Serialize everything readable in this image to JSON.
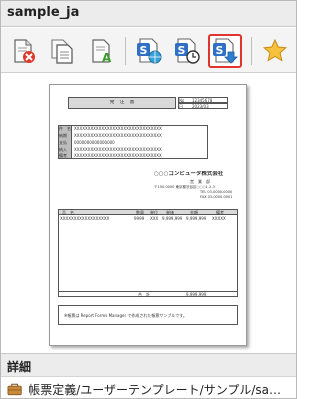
{
  "window": {
    "title": "sample_ja"
  },
  "toolbar": {
    "buttons": [
      {
        "name": "delete-form-button",
        "icon": "document-delete-icon"
      },
      {
        "name": "copy-form-button",
        "icon": "document-copy-icon"
      },
      {
        "name": "rename-form-button",
        "icon": "document-text-icon"
      },
      {
        "name": "preview-form-button",
        "icon": "s-document-globe-icon"
      },
      {
        "name": "schedule-form-button",
        "icon": "s-document-clock-icon"
      },
      {
        "name": "download-form-button",
        "icon": "s-document-download-icon",
        "active": true
      },
      {
        "name": "favorite-button",
        "icon": "star-icon"
      }
    ],
    "accent_color": "#e0342c"
  },
  "preview": {
    "doc_title": "発　注　書",
    "no_label": "No",
    "no_value": "12345678",
    "date_label": "日",
    "date_value": "2023/03",
    "field_labels": [
      "件　名",
      "納期",
      "支払",
      "納入",
      "備考"
    ],
    "field_value": "XXXXXXXXXXXXXXXXXXXXXXXXXXXXXXXX",
    "field_value_short": "0000000000000000",
    "company": "○○○コンピュータ株式会社",
    "company_dept": "営　業　部",
    "company_address": "〒150-0000 東京都渋谷区○○○1-2-3",
    "company_tel": "TEL 03-0000-0000",
    "company_fax": "FAX 03-0000-0001",
    "table_headers": [
      "品　名",
      "数量",
      "単位",
      "単価",
      "金額",
      "備考"
    ],
    "table_row": [
      "XXXXXXXXXXXXXXXXXX",
      "9999",
      "XXX",
      "9,999,999",
      "9,999,999",
      "XXXXX"
    ],
    "total_label": "合　計",
    "total_value": "9,999,999",
    "footer_note": "※帳票は Report Forms Manager で作成された帳票サンプルです。"
  },
  "details": {
    "heading": "詳細",
    "icon": "briefcase-icon",
    "path": "帳票定義/ユーザーテンプレート/サンプル/sampl..."
  }
}
